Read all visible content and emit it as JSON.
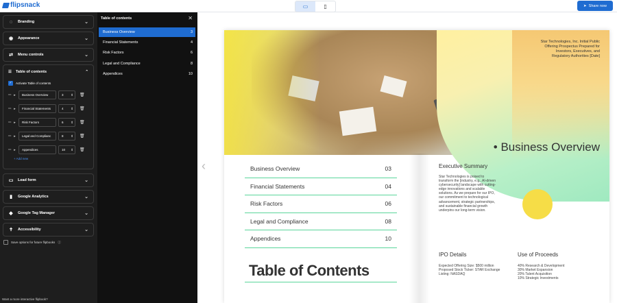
{
  "app": {
    "logo": "flipsnack",
    "share_label": "Share now",
    "device_desktop": "desktop-icon",
    "device_mobile": "mobile-icon"
  },
  "sidebar": {
    "sections_top": [
      {
        "label": "Branding",
        "icon": "◌"
      },
      {
        "label": "Appearance",
        "icon": "◉"
      },
      {
        "label": "Menu controls",
        "icon": "⇄"
      }
    ],
    "toc": {
      "label": "Table of contents",
      "activate_label": "Activate Table of contents",
      "rows": [
        {
          "name": "Business Overview",
          "page": "3"
        },
        {
          "name": "Financial Statements",
          "page": "4"
        },
        {
          "name": "Risk Factors",
          "page": "6"
        },
        {
          "name": "Legal and Complianc",
          "page": "8"
        },
        {
          "name": "Appendices",
          "page": "10"
        }
      ],
      "add_new": "+ Add new"
    },
    "sections_bottom": [
      {
        "label": "Lead form",
        "icon": "▭"
      },
      {
        "label": "Google Analytics",
        "icon": "▮"
      },
      {
        "label": "Google Tag Manager",
        "icon": "◆"
      },
      {
        "label": "Accessibility",
        "icon": "✝"
      }
    ],
    "save_label": "Save options for future flipbooks",
    "footer": "Want a more interactive flipbook?"
  },
  "toc_panel": {
    "title": "Table of contents",
    "items": [
      {
        "label": "Business Overview",
        "page": "3"
      },
      {
        "label": "Financial Statements",
        "page": "4"
      },
      {
        "label": "Risk Factors",
        "page": "6"
      },
      {
        "label": "Legal and Compliance",
        "page": "8"
      },
      {
        "label": "Appendices",
        "page": "10"
      }
    ]
  },
  "book": {
    "company": "Star Technologies, Inc. Initial Public Offering Prospectus Prepared for Investors, Executives, and Regulatory Authorities [Date]",
    "biz_title": "• Business Overview",
    "toc": [
      {
        "label": "Business Overview",
        "page": "03"
      },
      {
        "label": "Financial Statements",
        "page": "04"
      },
      {
        "label": "Risk Factors",
        "page": "06"
      },
      {
        "label": "Legal and Compliance",
        "page": "08"
      },
      {
        "label": "Appendices",
        "page": "10"
      }
    ],
    "big_title": "Table of Contents",
    "exec_title": "Executive Summary",
    "exec_text": "Star Technologies is poised to transform the [industry, e.g., AI-driven cybersecurity] landscape with cutting-edge innovations and scalable solutions. As we prepare for our IPO, our commitment to technological advancement, strategic partnerships, and sustainable financial growth underpins our long-term vision.",
    "ipo_title": "IPO Details",
    "ipo_text": "Expected Offering Size: $500 million Proposed Stock Ticker: STAR Exchange Listing: NASDAQ",
    "use_title": "Use of Proceeds",
    "use_lines": [
      "40% Research & Development",
      "30% Market Expansion",
      "20% Talent Acquisition",
      "10% Strategic Investments"
    ]
  }
}
